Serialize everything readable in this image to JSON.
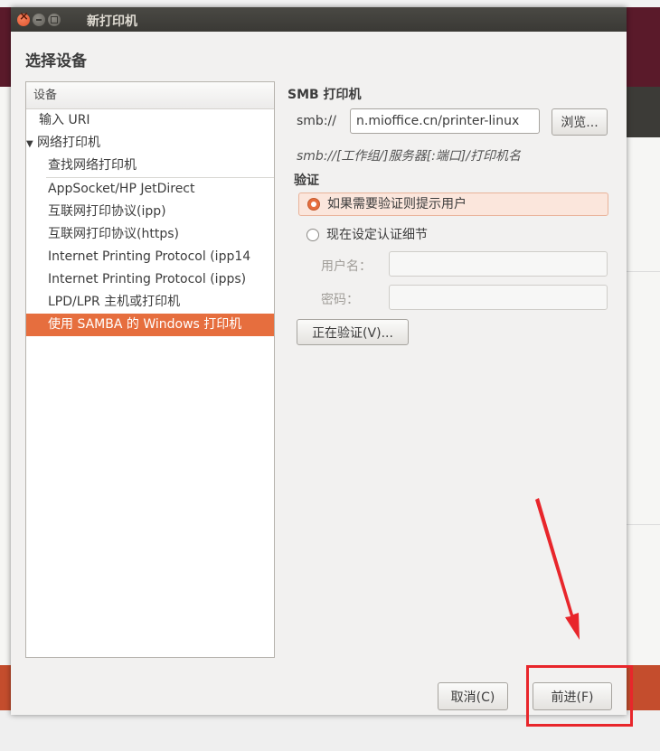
{
  "window": {
    "title": "新打印机"
  },
  "heading": "选择设备",
  "device_list": {
    "header": "设备",
    "items": [
      {
        "label": "输入 URI",
        "level": 0,
        "selected": false
      },
      {
        "label": "网络打印机",
        "level": "group",
        "expanded": true
      },
      {
        "label": "查找网络打印机",
        "level": 1,
        "selected": false
      },
      {
        "label": "AppSocket/HP JetDirect",
        "level": 1,
        "selected": false
      },
      {
        "label": "互联网打印协议(ipp)",
        "level": 1,
        "selected": false
      },
      {
        "label": "互联网打印协议(https)",
        "level": 1,
        "selected": false
      },
      {
        "label": "Internet Printing Protocol (ipp14",
        "level": 1,
        "selected": false
      },
      {
        "label": "Internet Printing Protocol (ipps)",
        "level": 1,
        "selected": false
      },
      {
        "label": "LPD/LPR 主机或打印机",
        "level": 1,
        "selected": false
      },
      {
        "label": "使用 SAMBA 的 Windows 打印机",
        "level": 1,
        "selected": true
      }
    ]
  },
  "smb": {
    "section_title": "SMB 打印机",
    "uri_prefix": "smb://",
    "uri_value": "n.mioffice.cn/printer-linux",
    "browse_label": "浏览...",
    "uri_hint": "smb://[工作组/]服务器[:端口]/打印机名"
  },
  "auth": {
    "label": "验证",
    "option_prompt": "如果需要验证则提示用户",
    "option_now": "现在设定认证细节",
    "username_label": "用户名：",
    "password_label": "密码：",
    "username_value": "",
    "password_value": "",
    "verify_label": "正在验证(V)..."
  },
  "buttons": {
    "cancel": "取消(C)",
    "forward": "前进(F)"
  },
  "colors": {
    "accent": "#e66e3e",
    "titlebar": "#3c3b37",
    "annotation": "#e8262b"
  }
}
